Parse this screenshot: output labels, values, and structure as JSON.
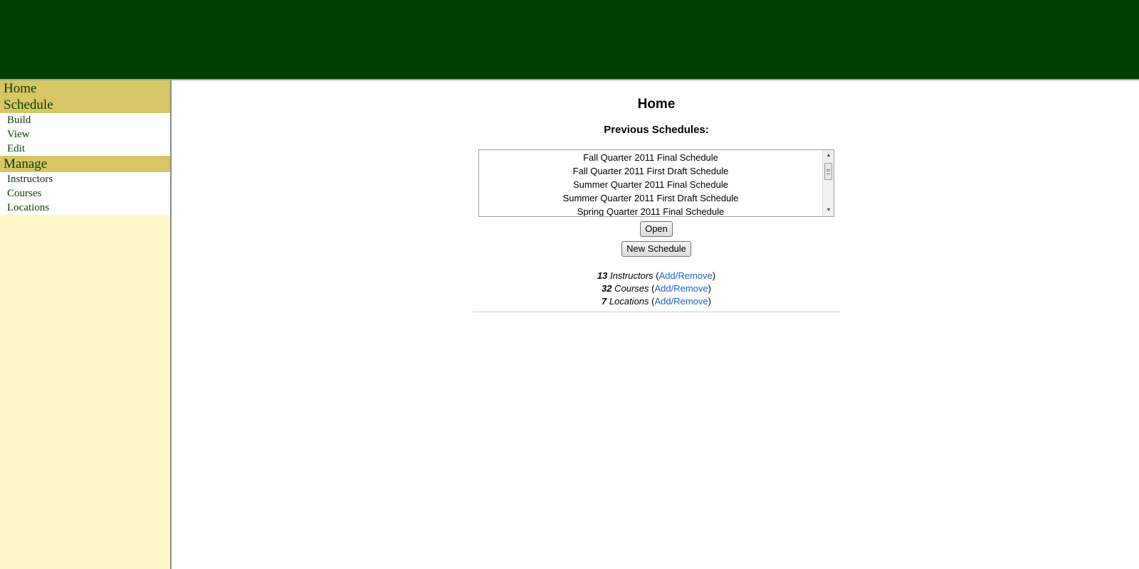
{
  "header": {
    "color": "#003f00"
  },
  "sidebar": {
    "sections": [
      {
        "label": "Home",
        "links": []
      },
      {
        "label": "Schedule",
        "links": [
          "Build",
          "View",
          "Edit"
        ]
      },
      {
        "label": "Manage",
        "links": [
          "Instructors",
          "Courses",
          "Locations"
        ]
      }
    ],
    "colors": {
      "section_bg": "#d6c665",
      "panel_bg": "#fff7c8",
      "link_color": "#0b3d00"
    }
  },
  "main": {
    "title": "Home",
    "previous_heading": "Previous Schedules:",
    "schedules": [
      "Fall Quarter 2011 Final Schedule",
      "Fall Quarter 2011 First Draft Schedule",
      "Summer Quarter 2011 Final Schedule",
      "Summer Quarter 2011 First Draft Schedule",
      "Spring Quarter 2011 Final Schedule"
    ],
    "open_button": "Open",
    "new_button": "New Schedule",
    "stats": [
      {
        "count": "13",
        "label": "Instructors",
        "link": "Add/Remove"
      },
      {
        "count": "32",
        "label": "Courses",
        "link": "Add/Remove"
      },
      {
        "count": "7",
        "label": "Locations",
        "link": "Add/Remove"
      }
    ],
    "link_color": "#1a63c9"
  }
}
